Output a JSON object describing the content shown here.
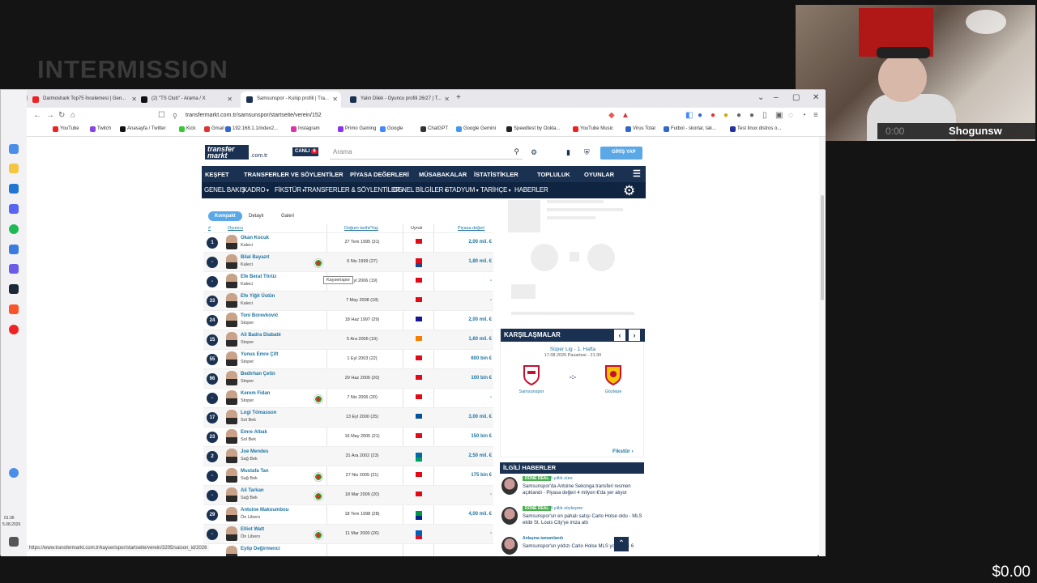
{
  "stream": {
    "scene_title": "INTERMISSION",
    "cam_time": "0:00",
    "streamer": "Shogunsw",
    "money": "$0.00"
  },
  "browser": {
    "tabs": [
      {
        "label": "Darmoshark Top75 İncelemesi | Gen...",
        "color": "#e22"
      },
      {
        "label": "(2) \"TS Club\" - Arama / X",
        "color": "#111"
      },
      {
        "label": "Samsunspor - Kulüp profili | Tra...",
        "color": "#1a3151"
      },
      {
        "label": "Yalın Dilek - Oyuncu profili 26/27 | T...",
        "color": "#1a3151"
      }
    ],
    "url": "transfermarkt.com.tr/samsunspor/startseite/verein/152",
    "bookmarks": [
      {
        "label": "YouTube",
        "color": "#e22"
      },
      {
        "label": "Twitch",
        "color": "#8a44e0"
      },
      {
        "label": "Anasayfa / Twitter",
        "color": "#111"
      },
      {
        "label": "Kick",
        "color": "#3c3"
      },
      {
        "label": "Gmail",
        "color": "#d33"
      },
      {
        "label": "192.168.1.1/index2...",
        "color": "#36c"
      },
      {
        "label": "Instagram",
        "color": "#d3a"
      },
      {
        "label": "Primo Gaming",
        "color": "#83e"
      },
      {
        "label": "Google",
        "color": "#48f"
      },
      {
        "label": "ChatGPT",
        "color": "#333"
      },
      {
        "label": "Google Gemini",
        "color": "#49e"
      },
      {
        "label": "Speedtest by Ookla...",
        "color": "#222"
      },
      {
        "label": "YouTube Music",
        "color": "#e22"
      },
      {
        "label": "Virus Total",
        "color": "#36c"
      },
      {
        "label": "Futbol - skorlar, tak...",
        "color": "#36c"
      },
      {
        "label": "Test linux distros o...",
        "color": "#239"
      }
    ],
    "status_url": "https://www.transfermarkt.com.tr/kayserispor/startseite/verein/3205/saison_id/2026",
    "clock": "01:36",
    "date": "5.08.2026"
  },
  "tm": {
    "logo_line1": "transfer",
    "logo_line2": "markt",
    "tld": ".com.tr",
    "live": "CANLI",
    "live_count": "6",
    "search_placeholder": "Arama",
    "login": "GİRİŞ YAP",
    "nav": [
      "KEŞFET",
      "TRANSFERLER VE SÖYLENTİLER",
      "PİYASA DEĞERLERİ",
      "MÜSABAKALAR",
      "İSTATİSTİKLER",
      "TOPLULUK",
      "OYUNLAR"
    ],
    "subnav": [
      "GENEL BAKIŞ",
      "KADRO",
      "FİKSTÜR",
      "TRANSFERLER & SÖYLENTİLER",
      "GENEL BİLGİLER",
      "STADYUM",
      "TARİHÇE",
      "HABERLER"
    ],
    "views": [
      "Kompakt",
      "Detaylı",
      "Galeri"
    ],
    "cols": {
      "num": "#",
      "player": "Oyuncu",
      "dob": "Doğum tarihi/Yaş",
      "nat": "Uyruk",
      "value": "Piyasa değeri"
    },
    "tooltip": "Kayserispor",
    "players": [
      {
        "num": "1",
        "name": "Okan Kocuk",
        "pos": "Kaleci",
        "dob": "27 Tem 1995 (31)",
        "value": "2,00 mil. €",
        "loan": false,
        "nat": [
          "#e30a17"
        ]
      },
      {
        "num": "-",
        "name": "Bilal Bayazıt",
        "pos": "Kaleci",
        "dob": "6 Nis 1999 (27)",
        "value": "1,80 mil. €",
        "loan": true,
        "nat": [
          "#e30a17",
          "#21468b"
        ]
      },
      {
        "num": "-",
        "name": "Efe Berat Törüz",
        "pos": "Kaleci",
        "dob": "8 Eyl 2006 (19)",
        "value": "-",
        "loan": false,
        "nat": [
          "#e30a17"
        ]
      },
      {
        "num": "33",
        "name": "Efe Yiğit Üstün",
        "pos": "Kaleci",
        "dob": "7 May 2008 (18)",
        "value": "-",
        "loan": false,
        "nat": [
          "#e30a17"
        ]
      },
      {
        "num": "24",
        "name": "Toni Borevković",
        "pos": "Stoper",
        "dob": "18 Haz 1997 (29)",
        "value": "2,00 mil. €",
        "loan": false,
        "nat": [
          "#171796"
        ]
      },
      {
        "num": "15",
        "name": "Ali Badra Diabaté",
        "pos": "Stoper",
        "dob": "5 Ara 2006 (19)",
        "value": "1,60 mil. €",
        "loan": false,
        "nat": [
          "#f77f00"
        ]
      },
      {
        "num": "55",
        "name": "Yunus Emre Çift",
        "pos": "Stoper",
        "dob": "1 Eyl 2003 (22)",
        "value": "600 bin €",
        "loan": false,
        "nat": [
          "#e30a17"
        ]
      },
      {
        "num": "96",
        "name": "Bedirhan Çetin",
        "pos": "Stoper",
        "dob": "29 Haz 2006 (20)",
        "value": "100 bin €",
        "loan": false,
        "nat": [
          "#e30a17"
        ]
      },
      {
        "num": "-",
        "name": "Kerem Fidan",
        "pos": "Stoper",
        "dob": "7 Nis 2006 (20)",
        "value": "-",
        "loan": true,
        "nat": [
          "#e30a17"
        ]
      },
      {
        "num": "17",
        "name": "Logi Tómasson",
        "pos": "Sol Bek",
        "dob": "13 Eyl 2000 (25)",
        "value": "3,00 mil. €",
        "loan": false,
        "nat": [
          "#02529c"
        ]
      },
      {
        "num": "23",
        "name": "Emre Albak",
        "pos": "Sol Bek",
        "dob": "16 May 2005 (21)",
        "value": "150 bin €",
        "loan": false,
        "nat": [
          "#e30a17"
        ]
      },
      {
        "num": "2",
        "name": "Joe Mendes",
        "pos": "Sağ Bek",
        "dob": "31 Ara 2002 (23)",
        "value": "2,50 mil. €",
        "loan": false,
        "nat": [
          "#006aa7",
          "#009e60"
        ]
      },
      {
        "num": "-",
        "name": "Mustafa Tan",
        "pos": "Sağ Bek",
        "dob": "27 Nis 2005 (21)",
        "value": "175 bin €",
        "loan": true,
        "nat": [
          "#e30a17"
        ]
      },
      {
        "num": "-",
        "name": "Ali Tarkan",
        "pos": "Sağ Bek",
        "dob": "18 Mar 2006 (20)",
        "value": "-",
        "loan": true,
        "nat": [
          "#e30a17"
        ]
      },
      {
        "num": "29",
        "name": "Antoine Makoumbou",
        "pos": "Ön Libero",
        "dob": "18 Tem 1998 (28)",
        "value": "4,00 mil. €",
        "loan": false,
        "nat": [
          "#009543",
          "#002395"
        ]
      },
      {
        "num": "-",
        "name": "Elliot Watt",
        "pos": "Ön Libero",
        "dob": "11 Mar 2000 (26)",
        "value": "-",
        "loan": true,
        "nat": [
          "#005eb8",
          "#cf142b"
        ]
      },
      {
        "num": "",
        "name": "Eylip Değirmenci",
        "pos": "",
        "dob": "",
        "value": "",
        "loan": false,
        "nat": []
      }
    ],
    "matches": {
      "title": "KARŞILAŞMALAR",
      "league": "Süper Lig - 1. Hafta",
      "date": "17.08.2026 Pazartesi - 21:30",
      "score": "-:-",
      "home": "Samsunspor",
      "away": "Göztepe",
      "fixtures": "Fikstür"
    },
    "news": {
      "title": "İLGİLİ HABERLER",
      "items": [
        {
          "tag": "DONE DEAL",
          "ago": "5 yıllık süre",
          "title": "Samsunspor'da Antoine Sekonga transferi resmen açıklandı - Piyasa değeri 4 milyon €'da yer alıyor"
        },
        {
          "tag": "DONE DEAL",
          "ago": "3 yıllık sözleşme",
          "title": "Samsunspor'un en pahalı satışı Carlo Holse oldu - MLS ekibi St. Louis City'ye imza attı"
        },
        {
          "tag": "Anlaşma tamamlandı",
          "ago": "",
          "title": "Samsunspor'un yıldızı Carlo Holse MLS yolunda - 6"
        }
      ]
    }
  }
}
